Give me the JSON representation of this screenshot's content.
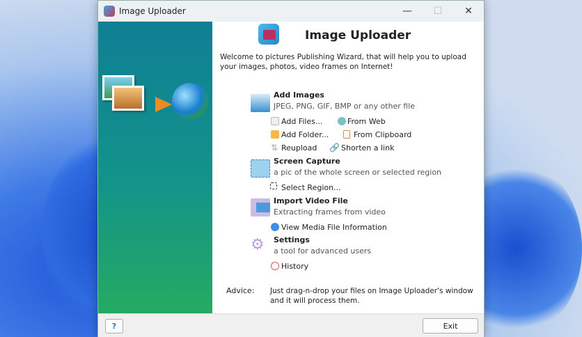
{
  "window": {
    "title": "Image Uploader"
  },
  "header": {
    "title": "Image Uploader",
    "welcome": "Welcome to pictures Publishing Wizard, that will help you to upload your images, photos, video frames on Internet!"
  },
  "add_images": {
    "title": "Add Images",
    "subtitle": "JPEG, PNG, GIF, BMP or any other file",
    "actions": [
      "Add Files...",
      "From Web",
      "Add Folder...",
      "From Clipboard",
      "Reupload",
      "Shorten a link"
    ]
  },
  "screen_capture": {
    "title": "Screen Capture",
    "subtitle": "a pic of the whole screen or selected region",
    "actions": [
      "Select Region..."
    ]
  },
  "import_video": {
    "title": "Import Video File",
    "subtitle": "Extracting frames from video",
    "actions": [
      "View Media File Information"
    ]
  },
  "settings": {
    "title": "Settings",
    "subtitle": "a tool for advanced users",
    "actions": [
      "History"
    ]
  },
  "advice": {
    "label": "Advice:",
    "text": "Just drag-n-drop your files on Image Uploader's window and it will process them."
  },
  "footer": {
    "help": "?",
    "exit": "Exit"
  }
}
